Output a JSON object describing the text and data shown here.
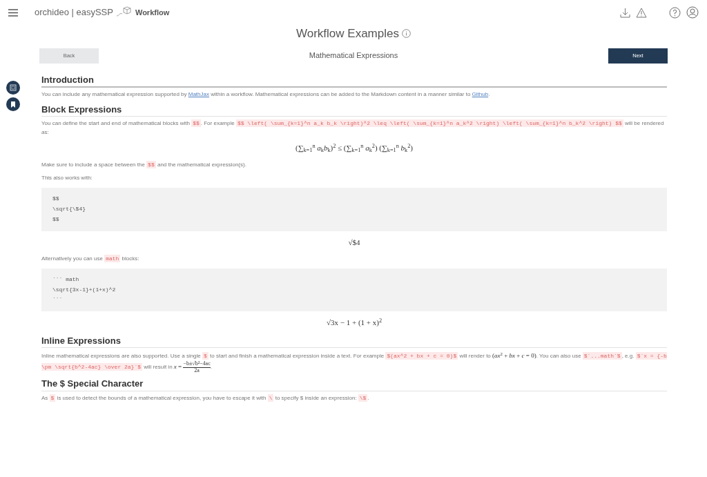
{
  "header": {
    "brand": "orchideo | easySSP",
    "product": "Workflow"
  },
  "title": "Workflow Examples",
  "nav": {
    "back": "Back",
    "step": "Mathematical Expressions",
    "next": "Next"
  },
  "sections": [
    {
      "heading": "Introduction",
      "major": true,
      "blocks": [
        {
          "kind": "para",
          "parts": [
            {
              "kind": "text",
              "text": "You can include any mathematical expression supported by "
            },
            {
              "kind": "link",
              "text": "MathJax"
            },
            {
              "kind": "text",
              "text": " within a workflow. Mathematical expressions can be added to the Markdown content in a manner similar to "
            },
            {
              "kind": "link",
              "text": "Github"
            },
            {
              "kind": "text",
              "text": "."
            }
          ]
        }
      ]
    },
    {
      "heading": "Block Expressions",
      "major": false,
      "blocks": [
        {
          "kind": "para",
          "parts": [
            {
              "kind": "text",
              "text": "You can define the start and end of mathematical blocks with "
            },
            {
              "kind": "code",
              "text": "$$"
            },
            {
              "kind": "text",
              "text": ". For example "
            },
            {
              "kind": "code",
              "text": "$$ \\left( \\sum_{k=1}^n a_k b_k \\right)^2 \\leq \\left( \\sum_{k=1}^n a_k^2 \\right) \\left( \\sum_{k=1}^n b_k^2 \\right) $$"
            },
            {
              "kind": "text",
              "text": " will be rendered as:"
            }
          ]
        },
        {
          "kind": "display",
          "text": "(∑$_{k=1}$$^{n}$ *a*$_{k}$*b*$_{k}$)$^{2}$ ≤ (∑$_{k=1}$$^{n}$ *a*$_{k}$$^{2}$) (∑$_{k=1}$$^{n}$ *b*$_{k}$$^{2}$)"
        },
        {
          "kind": "para",
          "parts": [
            {
              "kind": "text",
              "text": "Make sure to include a space between the "
            },
            {
              "kind": "code",
              "text": "$$"
            },
            {
              "kind": "text",
              "text": " and the mathematical expression(s)."
            }
          ]
        },
        {
          "kind": "para",
          "parts": [
            {
              "kind": "text",
              "text": "This also works with:"
            }
          ]
        },
        {
          "kind": "codeblock",
          "lines": [
            "$$",
            "\\sqrt{\\$4}",
            "$$"
          ]
        },
        {
          "kind": "display",
          "text": "√$4"
        },
        {
          "kind": "para",
          "parts": [
            {
              "kind": "text",
              "text": "Alternatively you can use "
            },
            {
              "kind": "code",
              "text": "math"
            },
            {
              "kind": "text",
              "text": " blocks:"
            }
          ]
        },
        {
          "kind": "codeblock",
          "lines": [
            "``` math",
            "\\sqrt{3x-1}+(1+x)^2",
            "```"
          ]
        },
        {
          "kind": "display",
          "text": "√3x − 1 + (1 + x)$^{2}$"
        }
      ]
    },
    {
      "heading": "Inline Expressions",
      "major": false,
      "blocks": [
        {
          "kind": "para",
          "parts": [
            {
              "kind": "text",
              "text": "Inline mathematical expressions are also supported. Use a single "
            },
            {
              "kind": "code",
              "text": "$"
            },
            {
              "kind": "text",
              "text": " to start and finish a mathematical expression inside a text. For example "
            },
            {
              "kind": "code",
              "text": "$(ax^2 + bx + c = 0)$"
            },
            {
              "kind": "text",
              "text": " will render to "
            },
            {
              "kind": "math",
              "text": "(*ax*$^{2}$ + *bx* + *c* = 0)"
            },
            {
              "kind": "text",
              "text": ". You can also use "
            },
            {
              "kind": "code",
              "text": "$`...math`$"
            },
            {
              "kind": "text",
              "text": ", e.g. "
            },
            {
              "kind": "code",
              "text": "$`x = {-b \\pm \\sqrt{b^2-4ac} \\over 2a}`$"
            },
            {
              "kind": "text",
              "text": " will result in "
            },
            {
              "kind": "math",
              "text": "*x* = "
            },
            {
              "kind": "frac",
              "num": "−b±√b²−4ac",
              "den": "2a"
            },
            {
              "kind": "text",
              "text": "."
            }
          ]
        }
      ]
    },
    {
      "heading": "The $ Special Character",
      "major": false,
      "blocks": [
        {
          "kind": "para",
          "parts": [
            {
              "kind": "text",
              "text": "As "
            },
            {
              "kind": "code",
              "text": "$"
            },
            {
              "kind": "text",
              "text": " is used to detect the bounds of a mathematical expression, you have to escape it with "
            },
            {
              "kind": "code",
              "text": "\\"
            },
            {
              "kind": "text",
              "text": " to specify $ inside an expression: "
            },
            {
              "kind": "code",
              "text": "\\$"
            },
            {
              "kind": "text",
              "text": "."
            }
          ]
        }
      ]
    }
  ]
}
